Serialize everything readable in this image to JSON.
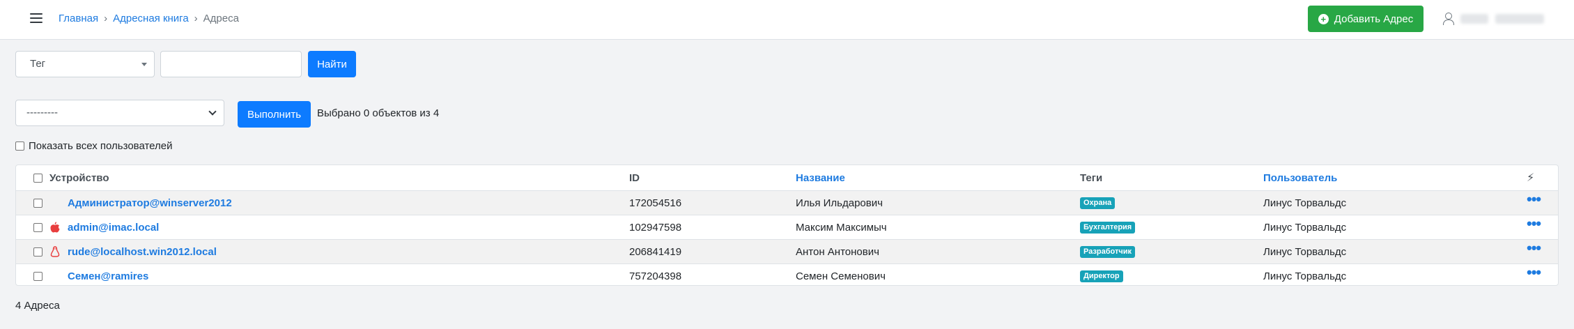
{
  "header": {
    "breadcrumb": [
      {
        "label": "Главная",
        "link": true
      },
      {
        "label": "Адресная книга",
        "link": true
      },
      {
        "label": "Адреса",
        "link": false
      }
    ],
    "add_button_label": "Добавить Адрес"
  },
  "filters": {
    "tag_select_value": "Тег",
    "search_value": "",
    "find_button_label": "Найти"
  },
  "actions": {
    "select_value": "---------",
    "execute_button_label": "Выполнить",
    "selected_info": "Выбрано 0 объектов из 4",
    "show_all_label": "Показать всех пользователей"
  },
  "table": {
    "columns": {
      "device": "Устройство",
      "id": "ID",
      "name": "Название",
      "tags": "Теги",
      "user": "Пользователь"
    },
    "rows": [
      {
        "device": "Администратор@winserver2012",
        "os_icon": "windows-icon",
        "id": "172054516",
        "name": "Илья Ильдарович",
        "tag": "Охрана",
        "user": "Линус Торвальдс"
      },
      {
        "device": "admin@imac.local",
        "os_icon": "apple-icon",
        "id": "102947598",
        "name": "Максим Максимыч",
        "tag": "Бухгалтерия",
        "user": "Линус Торвальдс"
      },
      {
        "device": "rude@localhost.win2012.local",
        "os_icon": "linux-icon",
        "id": "206841419",
        "name": "Антон Антонович",
        "tag": "Разработчик",
        "user": "Линус Торвальдс"
      },
      {
        "device": "Семен@ramires",
        "os_icon": "windows-icon",
        "id": "757204398",
        "name": "Семен Семенович",
        "tag": "Директор",
        "user": "Линус Торвальдс"
      }
    ]
  },
  "footer": {
    "count_label": "4 Адреса"
  },
  "colors": {
    "primary": "#0d7bff",
    "success": "#28a745",
    "link": "#1e7be0",
    "badge": "#17a2b8",
    "os_icon": "#e83e3e"
  }
}
